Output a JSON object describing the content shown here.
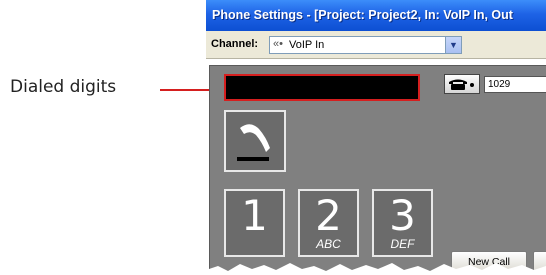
{
  "callout": {
    "label": "Dialed digits",
    "line_color": "#d51f1f"
  },
  "window": {
    "title": "Phone Settings - [Project: Project2, In: VoIP In, Out"
  },
  "toolbar": {
    "channel_label": "Channel:",
    "channel_value": "VoIP In",
    "channel_icon": "connection-icon"
  },
  "phone_panel": {
    "dialed_digits": "",
    "line_number": "1029",
    "handset_icon": "handset-icon",
    "keypad": [
      {
        "digit": "1",
        "letters": ""
      },
      {
        "digit": "2",
        "letters": "ABC"
      },
      {
        "digit": "3",
        "letters": "DEF"
      }
    ],
    "new_call_label": "New Call"
  },
  "colors": {
    "title_bar": "#1e63e6",
    "panel": "#808080",
    "highlight": "#d51f1f"
  }
}
